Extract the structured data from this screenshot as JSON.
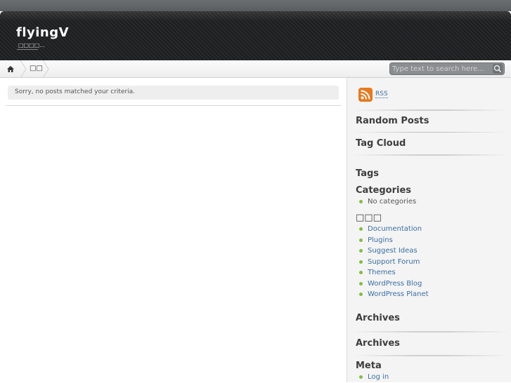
{
  "header": {
    "site_title": "flyingV",
    "site_description": "□□□□..."
  },
  "nav": {
    "home_icon": "home-icon",
    "item_label": "□□"
  },
  "search": {
    "placeholder": "Type text to search here...",
    "button_icon": "magnifier-icon"
  },
  "main": {
    "notice": "Sorry, no posts matched your criteria."
  },
  "sidebar": {
    "rss_label": "RSS",
    "rss_icon": "rss-icon",
    "random_posts_title": "Random Posts",
    "tag_cloud_title": "Tag Cloud",
    "tags_title": "Tags",
    "categories_title": "Categories",
    "categories_items": [
      "No categories"
    ],
    "links_title": "□□□",
    "links_items": [
      "Documentation",
      "Plugins",
      "Suggest Ideas",
      "Support Forum",
      "Themes",
      "WordPress Blog",
      "WordPress Planet"
    ],
    "archives_title_1": "Archives",
    "archives_title_2": "Archives",
    "meta_title": "Meta",
    "meta_items": [
      "Log in"
    ]
  },
  "colors": {
    "link": "#3a6ea5",
    "bullet": "#7fbf3f",
    "header_bg": "#1d1e20",
    "rss_orange": "#e2701a"
  }
}
